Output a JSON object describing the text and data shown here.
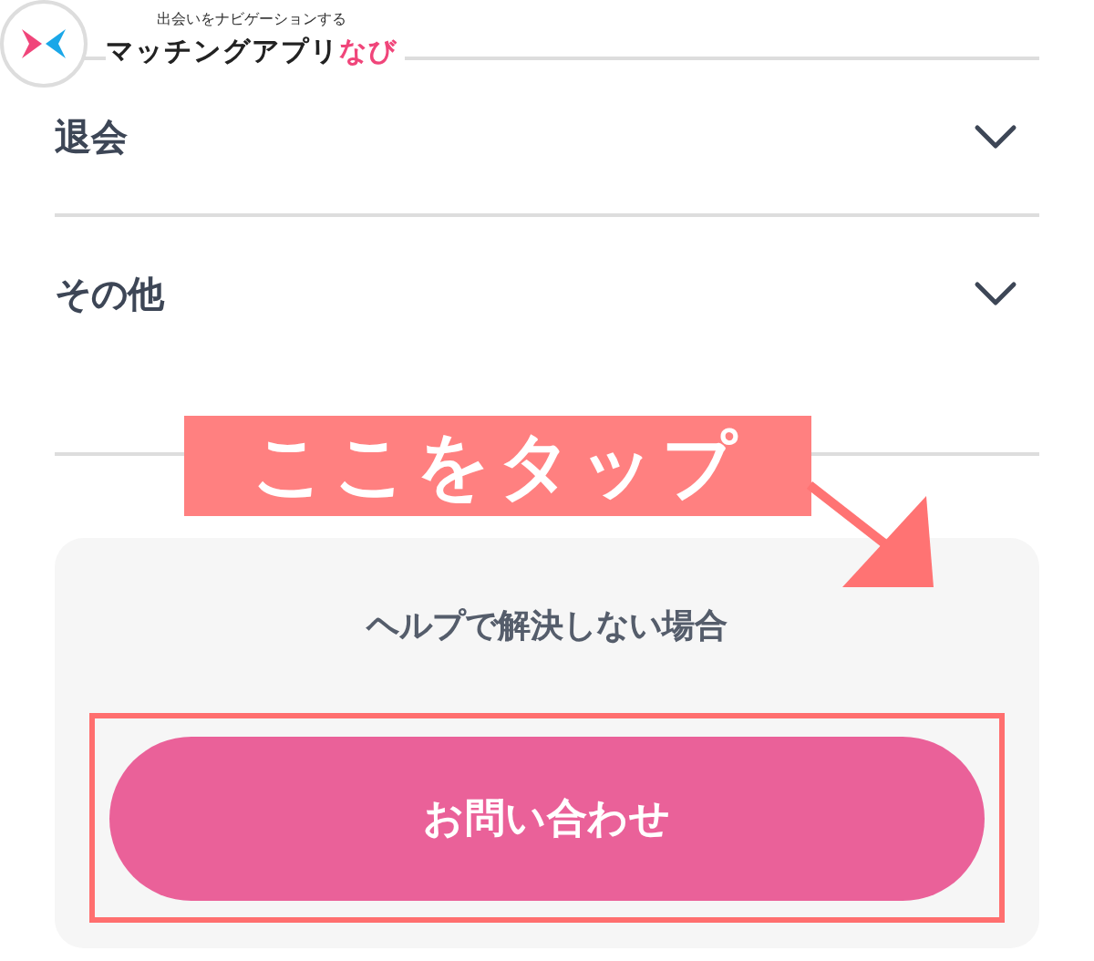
{
  "header": {
    "tagline": "出会いをナビゲーションする",
    "brand": "マッチングアプリ",
    "brand_accent": "なび"
  },
  "faq_sections": [
    {
      "label": "退会",
      "expanded": false
    },
    {
      "label": "その他",
      "expanded": false
    }
  ],
  "contact_card": {
    "heading": "ヘルプで解決しない場合",
    "button": "お問い合わせ"
  },
  "annotation": {
    "label": "ここをタップ"
  }
}
